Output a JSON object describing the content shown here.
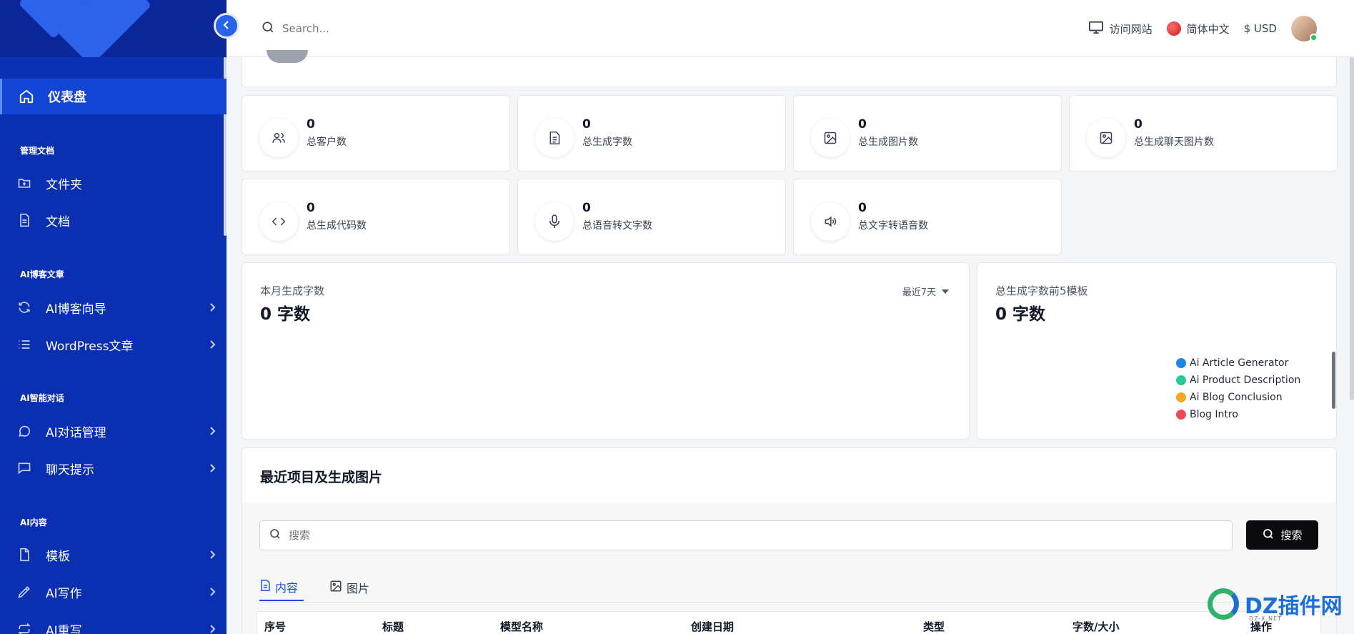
{
  "header": {
    "search_placeholder": "Search...",
    "visit_site": "访问网站",
    "language": "简体中文",
    "currency": "$ USD"
  },
  "sidebar": {
    "active_item": "仪表盘",
    "sections": [
      {
        "title": "管理文档",
        "items": [
          {
            "label": "文件夹",
            "icon": "folder-plus-icon",
            "chevron": false
          },
          {
            "label": "文档",
            "icon": "document-icon",
            "chevron": false
          }
        ]
      },
      {
        "title": "AI博客文章",
        "items": [
          {
            "label": "AI博客向导",
            "icon": "refresh-icon",
            "chevron": true
          },
          {
            "label": "WordPress文章",
            "icon": "list-icon",
            "chevron": true
          }
        ]
      },
      {
        "title": "AI智能对话",
        "items": [
          {
            "label": "AI对话管理",
            "icon": "chat-bubble-icon",
            "chevron": true
          },
          {
            "label": "聊天提示",
            "icon": "message-square-icon",
            "chevron": true
          }
        ]
      },
      {
        "title": "AI内容",
        "items": [
          {
            "label": "模板",
            "icon": "file-icon",
            "chevron": true
          },
          {
            "label": "AI写作",
            "icon": "pen-icon",
            "chevron": true
          },
          {
            "label": "AI重写",
            "icon": "repeat-icon",
            "chevron": true
          }
        ]
      }
    ]
  },
  "stats": [
    {
      "value": "0",
      "label": "总客户数",
      "icon": "users-icon"
    },
    {
      "value": "0",
      "label": "总生成字数",
      "icon": "file-text-icon"
    },
    {
      "value": "0",
      "label": "总生成图片数",
      "icon": "image-icon"
    },
    {
      "value": "0",
      "label": "总生成聊天图片数",
      "icon": "image-icon"
    },
    {
      "value": "0",
      "label": "总生成代码数",
      "icon": "code-icon"
    },
    {
      "value": "0",
      "label": "总语音转文字数",
      "icon": "microphone-icon"
    },
    {
      "value": "0",
      "label": "总文字转语音数",
      "icon": "speaker-icon"
    }
  ],
  "monthly_panel": {
    "subtitle": "本月生成字数",
    "value": "0 字数",
    "range": "最近7天"
  },
  "top5_panel": {
    "subtitle": "总生成字数前5模板",
    "value": "0 字数",
    "legend": [
      {
        "label": "Ai Article Generator",
        "color": "#1e88e5"
      },
      {
        "label": "Ai Product Description",
        "color": "#26c99a"
      },
      {
        "label": "Ai Blog Conclusion",
        "color": "#f5a623"
      },
      {
        "label": "Blog Intro",
        "color": "#ef4a5a"
      }
    ]
  },
  "recent": {
    "title": "最近项目及生成图片",
    "search_placeholder": "搜索",
    "search_button": "搜索",
    "tabs": [
      {
        "label": "内容",
        "active": true
      },
      {
        "label": "图片",
        "active": false
      }
    ],
    "columns": [
      "序号",
      "标题",
      "模型名称",
      "创建日期",
      "类型",
      "字数/大小",
      "操作"
    ]
  },
  "watermark": {
    "brand": "DZ插件网",
    "sub": "DZ-X.NET"
  }
}
